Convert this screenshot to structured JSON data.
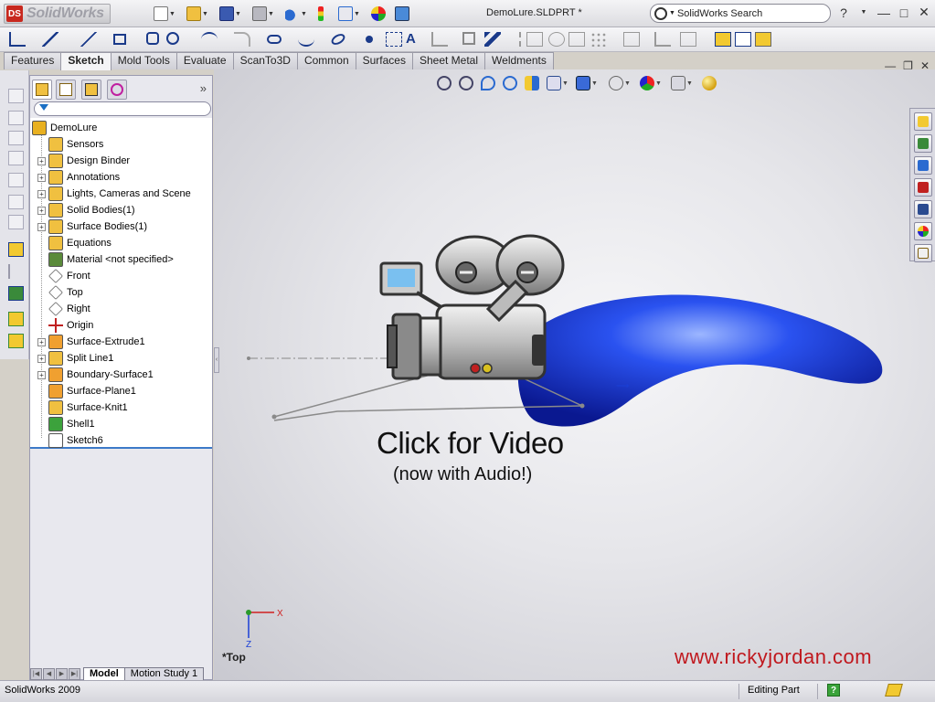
{
  "app": {
    "logo_text": "SolidWorks",
    "document_title": "DemoLure.SLDPRT *",
    "search_placeholder": "SolidWorks Search",
    "help_icon": "?",
    "quick_access_icons": [
      "new-document-icon",
      "open-icon",
      "save-icon",
      "print-icon",
      "undo-icon",
      "rebuild-icon",
      "options-icon",
      "appearance-icon",
      "view-icon"
    ]
  },
  "command_tabs": [
    {
      "label": "Features"
    },
    {
      "label": "Sketch",
      "active": true
    },
    {
      "label": "Mold Tools"
    },
    {
      "label": "Evaluate"
    },
    {
      "label": "ScanTo3D"
    },
    {
      "label": "Common"
    },
    {
      "label": "Surfaces"
    },
    {
      "label": "Sheet Metal"
    },
    {
      "label": "Weldments"
    }
  ],
  "feature_manager": {
    "tab_icons": [
      "feature-tree-icon",
      "property-manager-icon",
      "configuration-manager-icon",
      "dimxpert-icon"
    ],
    "tree": [
      {
        "label": "DemoLure",
        "expandable": false,
        "root": true,
        "icon": "part-icon",
        "color": "#e8b020"
      },
      {
        "label": "Sensors",
        "expandable": false,
        "icon": "sensors-folder-icon",
        "color": "#f0c040"
      },
      {
        "label": "Design Binder",
        "expandable": true,
        "icon": "design-binder-icon",
        "color": "#f0c040"
      },
      {
        "label": "Annotations",
        "expandable": true,
        "icon": "annotations-icon",
        "color": "#f0c040"
      },
      {
        "label": "Lights, Cameras and Scene",
        "expandable": true,
        "icon": "lights-folder-icon",
        "color": "#f0c040"
      },
      {
        "label": "Solid Bodies(1)",
        "expandable": true,
        "icon": "solid-bodies-icon",
        "color": "#f0c040"
      },
      {
        "label": "Surface Bodies(1)",
        "expandable": true,
        "icon": "surface-bodies-icon",
        "color": "#f0c040"
      },
      {
        "label": "Equations",
        "expandable": false,
        "icon": "equations-icon",
        "color": "#f0c040"
      },
      {
        "label": "Material <not specified>",
        "expandable": false,
        "icon": "material-icon",
        "color": "#5a8a3a"
      },
      {
        "label": "Front",
        "expandable": false,
        "icon": "plane-icon",
        "color": "#ffffff"
      },
      {
        "label": "Top",
        "expandable": false,
        "icon": "plane-icon",
        "color": "#ffffff"
      },
      {
        "label": "Right",
        "expandable": false,
        "icon": "plane-icon",
        "color": "#ffffff"
      },
      {
        "label": "Origin",
        "expandable": false,
        "icon": "origin-icon",
        "color": "#ffffff"
      },
      {
        "label": "Surface-Extrude1",
        "expandable": true,
        "icon": "surface-extrude-icon",
        "color": "#f0a030"
      },
      {
        "label": "Split Line1",
        "expandable": true,
        "icon": "split-line-icon",
        "color": "#f0c040"
      },
      {
        "label": "Boundary-Surface1",
        "expandable": true,
        "icon": "boundary-surface-icon",
        "color": "#f0a030"
      },
      {
        "label": "Surface-Plane1",
        "expandable": false,
        "icon": "surface-plane-icon",
        "color": "#f0a030"
      },
      {
        "label": "Surface-Knit1",
        "expandable": false,
        "icon": "surface-knit-icon",
        "color": "#f0c040"
      },
      {
        "label": "Shell1",
        "expandable": false,
        "icon": "shell-icon",
        "color": "#3ca23c"
      },
      {
        "label": "Sketch6",
        "expandable": false,
        "icon": "sketch-icon",
        "color": "#ffffff"
      }
    ]
  },
  "bottom_tabs": [
    {
      "label": "Model",
      "active": true
    },
    {
      "label": "Motion Study 1"
    }
  ],
  "graphics": {
    "cta_title": "Click for Video",
    "cta_subtitle": "(now with Audio!)",
    "view_name": "*Top",
    "watermark": "www.rickyjordan.com",
    "triad_x": "X",
    "triad_z": "Z",
    "model_color": "#1a3fd6",
    "heads_up_icons": [
      "zoom-to-fit-icon",
      "zoom-to-area-icon",
      "previous-view-icon",
      "rotate-icon",
      "section-view-icon",
      "view-orientation-icon",
      "display-style-icon",
      "hide-show-icon",
      "edit-appearance-icon",
      "apply-scene-icon",
      "realview-icon"
    ],
    "task_pane_icons": [
      "home-icon",
      "design-library-icon",
      "file-explorer-icon",
      "search-icon",
      "view-palette-icon",
      "appearances-icon",
      "custom-properties-icon"
    ]
  },
  "status_bar": {
    "app_version": "SolidWorks 2009",
    "mode": "Editing Part"
  }
}
